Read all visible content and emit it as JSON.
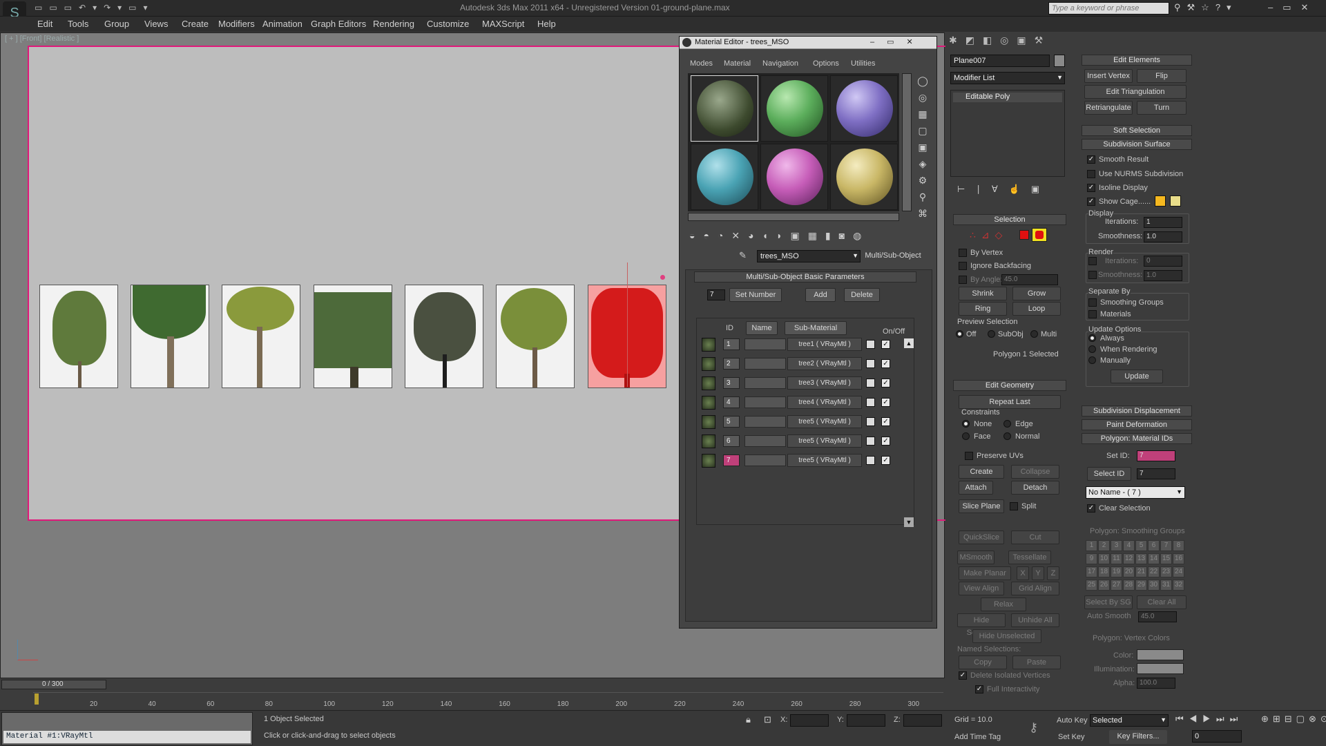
{
  "app": {
    "title": "Autodesk 3ds Max  2011 x64  - Unregistered Version   01-ground-plane.max",
    "search_placeholder": "Type a keyword or phrase"
  },
  "menu": [
    "Edit",
    "Tools",
    "Group",
    "Views",
    "Create",
    "Modifiers",
    "Animation",
    "Graph Editors",
    "Rendering",
    "Customize",
    "MAXScript",
    "Help"
  ],
  "viewport": {
    "label": "[ + ] [Front] [Realistic ]"
  },
  "material_editor": {
    "title": "Material Editor - trees_MSO",
    "menu": [
      "Modes",
      "Material",
      "Navigation",
      "Options",
      "Utilities"
    ],
    "material_name": "trees_MSO",
    "material_type": "Multi/Sub-Object",
    "rollout": "Multi/Sub-Object Basic Parameters",
    "count": "7",
    "set_number": "Set Number",
    "add": "Add",
    "delete": "Delete",
    "headers": {
      "id": "ID",
      "name": "Name",
      "sub": "Sub-Material",
      "onoff": "On/Off"
    },
    "rows": [
      {
        "id": "1",
        "sub": "tree1  ( VRayMtl )"
      },
      {
        "id": "2",
        "sub": "tree2  ( VRayMtl )"
      },
      {
        "id": "3",
        "sub": "tree3  ( VRayMtl )"
      },
      {
        "id": "4",
        "sub": "tree4  ( VRayMtl )"
      },
      {
        "id": "5",
        "sub": "tree5  ( VRayMtl )"
      },
      {
        "id": "6",
        "sub": "tree5  ( VRayMtl )"
      },
      {
        "id": "7",
        "sub": "tree5  ( VRayMtl )"
      }
    ],
    "colors": {
      "sphere2": "#5cae5c",
      "sphere3": "#7f6fc4",
      "sphere4": "#4aa3b4",
      "sphere5": "#c65db8",
      "sphere6": "#c9b766"
    }
  },
  "command_panel": {
    "object_name": "Plane007",
    "modifier_list": "Modifier List",
    "stack_item": "Editable Poly",
    "selection": {
      "title": "Selection",
      "by_vertex": "By Vertex",
      "ignore_backfacing": "Ignore Backfacing",
      "by_angle": "By Angle:",
      "angle_value": "45.0",
      "shrink": "Shrink",
      "grow": "Grow",
      "ring": "Ring",
      "loop": "Loop",
      "preview": "Preview Selection",
      "off": "Off",
      "subobj": "SubObj",
      "multi": "Multi",
      "status": "Polygon 1 Selected"
    },
    "edit_geometry": {
      "title": "Edit Geometry",
      "repeat_last": "Repeat Last",
      "constraints": "Constraints",
      "none": "None",
      "edge": "Edge",
      "face": "Face",
      "normal": "Normal",
      "preserve_uvs": "Preserve UVs",
      "create": "Create",
      "collapse": "Collapse",
      "attach": "Attach",
      "detach": "Detach",
      "slice_plane": "Slice Plane",
      "split": "Split",
      "quickslice": "QuickSlice",
      "cut": "Cut",
      "msmooth": "MSmooth",
      "tessellate": "Tessellate",
      "make_planar": "Make Planar",
      "x": "X",
      "y": "Y",
      "z": "Z",
      "view_align": "View Align",
      "grid_align": "Grid Align",
      "relax": "Relax",
      "hide_selected": "Hide Selected",
      "unhide_all": "Unhide All",
      "hide_unselected": "Hide Unselected",
      "named_selections": "Named Selections:",
      "copy": "Copy",
      "paste": "Paste",
      "delete_isolated": "Delete Isolated Vertices",
      "full_interactivity": "Full Interactivity"
    },
    "edit_elements": {
      "title": "Edit Elements",
      "insert_vertex": "Insert Vertex",
      "flip": "Flip",
      "edit_triangulation": "Edit Triangulation",
      "retriangulate": "Retriangulate",
      "turn": "Turn"
    },
    "soft_selection": "Soft Selection",
    "subdivision_surface": {
      "title": "Subdivision Surface",
      "smooth_result": "Smooth Result",
      "use_nurms": "Use NURMS Subdivision",
      "isoline": "Isoline Display",
      "show_cage": "Show Cage......",
      "cage_color1": "#f5b820",
      "cage_color2": "#e9dd8a",
      "display": "Display",
      "iterations": "Iterations:",
      "iter_value": "1",
      "smoothness": "Smoothness:",
      "smooth_value": "1.0",
      "render": "Render",
      "r_iter_value": "0",
      "r_smooth_value": "1.0",
      "separate_by": "Separate By",
      "smoothing_groups": "Smoothing Groups",
      "materials": "Materials",
      "update_options": "Update Options",
      "always": "Always",
      "when_rendering": "When Rendering",
      "manually": "Manually",
      "update": "Update"
    },
    "subdivision_displacement": "Subdivision Displacement",
    "paint_deformation": "Paint Deformation",
    "material_ids": {
      "title": "Polygon: Material IDs",
      "set_id": "Set ID:",
      "set_id_value": "7",
      "select_id": "Select ID",
      "select_id_value": "7",
      "name_dropdown": "No Name - ( 7 )",
      "clear_selection": "Clear Selection"
    },
    "smoothing_groups": {
      "title": "Polygon: Smoothing Groups",
      "numbers": [
        "1",
        "2",
        "3",
        "4",
        "5",
        "6",
        "7",
        "8",
        "9",
        "10",
        "11",
        "12",
        "13",
        "14",
        "15",
        "16",
        "17",
        "18",
        "19",
        "20",
        "21",
        "22",
        "23",
        "24",
        "25",
        "26",
        "27",
        "28",
        "29",
        "30",
        "31",
        "32"
      ],
      "select_by_sg": "Select By SG",
      "clear_all": "Clear All",
      "auto_smooth": "Auto Smooth",
      "auto_value": "45.0"
    },
    "vertex_colors": {
      "title": "Polygon: Vertex Colors",
      "color": "Color:",
      "illumination": "Illumination:",
      "alpha": "Alpha:",
      "alpha_value": "100.0"
    }
  },
  "timeline": {
    "frame": "0 / 300",
    "ticks": [
      "20",
      "40",
      "60",
      "80",
      "100",
      "120",
      "140",
      "160",
      "180",
      "200",
      "220",
      "240",
      "260",
      "280",
      "300"
    ]
  },
  "status": {
    "material": "Material #1:VRayMtl",
    "objects": "1 Object Selected",
    "prompt": "Click or click-and-drag to select objects",
    "x": "X:",
    "y": "Y:",
    "z": "Z:",
    "grid": "Grid = 10.0",
    "add_time_tag": "Add Time Tag",
    "auto_key": "Auto Key",
    "set_key": "Set Key",
    "selected": "Selected",
    "key_filters": "Key Filters...",
    "frame_value": "0"
  }
}
